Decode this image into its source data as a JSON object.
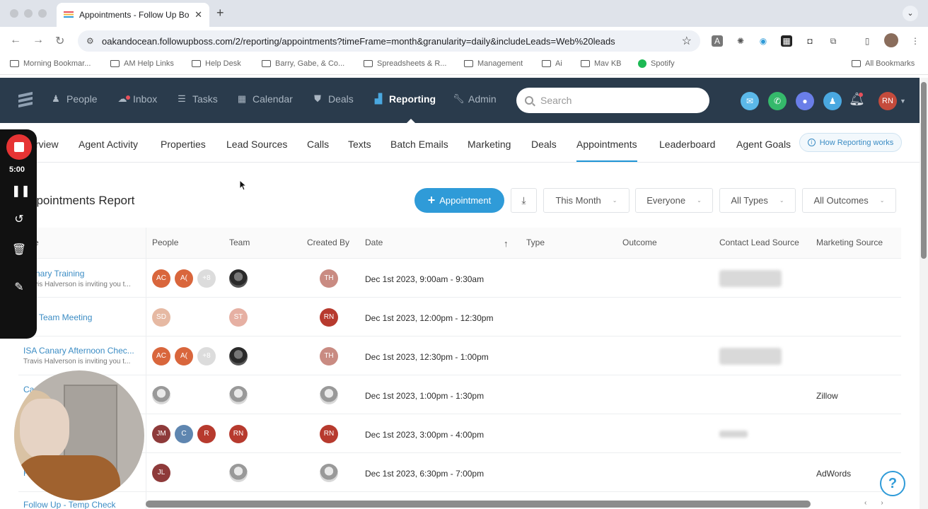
{
  "browser": {
    "tab_title": "Appointments - Follow Up Bo",
    "url": "oakandocean.followupboss.com/2/reporting/appointments?timeFrame=month&granularity=daily&includeLeads=Web%20leads",
    "bookmarks": [
      "Morning Bookmar...",
      "AM Help Links",
      "Help Desk",
      "Barry, Gabe, & Co...",
      "Spreadsheets & R...",
      "Management",
      "Ai",
      "Mav KB",
      "Spotify"
    ],
    "all_bookmarks": "All Bookmarks"
  },
  "topnav": {
    "items": [
      {
        "label": "People",
        "icon": "person-icon"
      },
      {
        "label": "Inbox",
        "icon": "inbox-icon"
      },
      {
        "label": "Tasks",
        "icon": "tasks-icon"
      },
      {
        "label": "Calendar",
        "icon": "calendar-icon"
      },
      {
        "label": "Deals",
        "icon": "deals-icon"
      },
      {
        "label": "Reporting",
        "icon": "reporting-icon"
      },
      {
        "label": "Admin",
        "icon": "wrench-icon"
      }
    ],
    "search_placeholder": "Search",
    "user_initials": "RN",
    "colors": {
      "bg": "#2a3b4c",
      "accent": "#2f9bd8"
    }
  },
  "subnav": {
    "items": [
      "rview",
      "Agent Activity",
      "Properties",
      "Lead Sources",
      "Calls",
      "Texts",
      "Batch Emails",
      "Marketing",
      "Deals",
      "Appointments",
      "Leaderboard",
      "Agent Goals"
    ],
    "active": "Appointments",
    "help_label": "How Reporting works"
  },
  "report": {
    "title": "ppointments Report",
    "add_button": "Appointment",
    "filters": {
      "time": "This Month",
      "agent": "Everyone",
      "types": "All Types",
      "outcomes": "All Outcomes"
    }
  },
  "table": {
    "columns": [
      "e",
      "People",
      "Team",
      "Created By",
      "Date",
      "Type",
      "Outcome",
      "Contact Lead Source",
      "Marketing Source"
    ],
    "rows": [
      {
        "name": "nary Training",
        "sub": "vis Halverson is inviting you t...",
        "people": [
          "AC",
          "A(",
          "+8"
        ],
        "team": "",
        "created": "TH",
        "date": "Dec 1st 2023, 9:00am - 9:30am",
        "marketing": ""
      },
      {
        "name": "Team Meeting",
        "sub": "",
        "people": [
          "SD"
        ],
        "team": "ST",
        "created": "RN",
        "date": "Dec 1st 2023, 12:00pm - 12:30pm",
        "marketing": ""
      },
      {
        "name": "ISA Canary Afternoon Chec...",
        "sub": "Travis Halverson is inviting you t...",
        "people": [
          "AC",
          "A(",
          "+8"
        ],
        "team": "",
        "created": "TH",
        "date": "Dec 1st 2023, 12:30pm - 1:00pm",
        "marketing": ""
      },
      {
        "name": "Ca",
        "sub": "",
        "people": [
          ""
        ],
        "team": "",
        "created": "",
        "date": "Dec 1st 2023, 1:00pm - 1:30pm",
        "marketing": "Zillow"
      },
      {
        "name": "",
        "sub": "",
        "people": [
          "JM",
          "C",
          "R"
        ],
        "team": "RN",
        "created": "RN",
        "date": "Dec 1st 2023, 3:00pm - 4:00pm",
        "marketing": ""
      },
      {
        "name": "F",
        "sub": "",
        "people": [
          "JL"
        ],
        "team": "",
        "created": "",
        "date": "Dec 1st 2023, 6:30pm - 7:00pm",
        "marketing": "AdWords"
      },
      {
        "name": "Follow Up - Temp Check",
        "sub": "",
        "people": [],
        "team": "",
        "created": "",
        "date": "",
        "marketing": ""
      }
    ]
  },
  "recorder": {
    "time": "5:00"
  }
}
